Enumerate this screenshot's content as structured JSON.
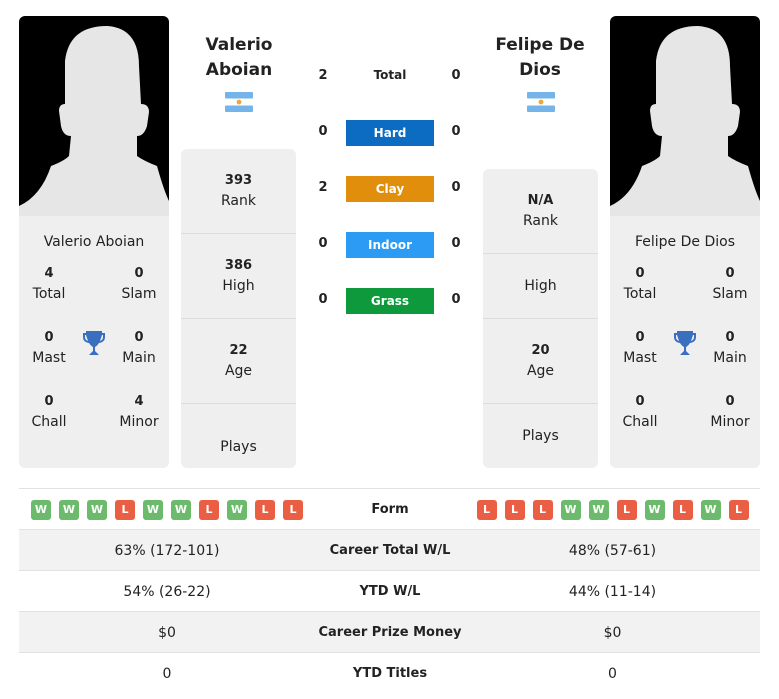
{
  "player1": {
    "name": "Valerio Aboian",
    "name_line1": "Valerio",
    "name_line2": "Aboian",
    "country_flag": "argentina-flag",
    "titles": {
      "total": {
        "value": "4",
        "label": "Total"
      },
      "slam": {
        "value": "0",
        "label": "Slam"
      },
      "mast": {
        "value": "0",
        "label": "Mast"
      },
      "main": {
        "value": "0",
        "label": "Main"
      },
      "chall": {
        "value": "0",
        "label": "Chall"
      },
      "minor": {
        "value": "4",
        "label": "Minor"
      }
    },
    "stats": {
      "rank": {
        "value": "393",
        "label": "Rank"
      },
      "high": {
        "value": "386",
        "label": "High"
      },
      "age": {
        "value": "22",
        "label": "Age"
      },
      "plays": {
        "value": "",
        "label": "Plays"
      }
    },
    "form": [
      "W",
      "W",
      "W",
      "L",
      "W",
      "W",
      "L",
      "W",
      "L",
      "L"
    ],
    "career_total_wl": "63% (172-101)",
    "ytd_wl": "54% (26-22)",
    "career_prize_money": "$0",
    "ytd_titles": "0"
  },
  "player2": {
    "name": "Felipe De Dios",
    "name_line1": "Felipe De",
    "name_line2": "Dios",
    "country_flag": "argentina-flag",
    "titles": {
      "total": {
        "value": "0",
        "label": "Total"
      },
      "slam": {
        "value": "0",
        "label": "Slam"
      },
      "mast": {
        "value": "0",
        "label": "Mast"
      },
      "main": {
        "value": "0",
        "label": "Main"
      },
      "chall": {
        "value": "0",
        "label": "Chall"
      },
      "minor": {
        "value": "0",
        "label": "Minor"
      }
    },
    "stats": {
      "rank": {
        "value": "N/A",
        "label": "Rank"
      },
      "high": {
        "value": "",
        "label": "High"
      },
      "age": {
        "value": "20",
        "label": "Age"
      },
      "plays": {
        "value": "",
        "label": "Plays"
      }
    },
    "form": [
      "L",
      "L",
      "L",
      "W",
      "W",
      "L",
      "W",
      "L",
      "W",
      "L"
    ],
    "career_total_wl": "48% (57-61)",
    "ytd_wl": "44% (11-14)",
    "career_prize_money": "$0",
    "ytd_titles": "0"
  },
  "h2h": {
    "total": {
      "label": "Total",
      "p1": "2",
      "p2": "0"
    },
    "surfaces": [
      {
        "label": "Hard",
        "p1": "0",
        "p2": "0",
        "color": "#0b6cc2"
      },
      {
        "label": "Clay",
        "p1": "2",
        "p2": "0",
        "color": "#e08e0b"
      },
      {
        "label": "Indoor",
        "p1": "0",
        "p2": "0",
        "color": "#2b9bf4"
      },
      {
        "label": "Grass",
        "p1": "0",
        "p2": "0",
        "color": "#0e9a3c"
      }
    ]
  },
  "table": {
    "form_label": "Form",
    "career_total_wl_label": "Career Total W/L",
    "ytd_wl_label": "YTD W/L",
    "career_prize_money_label": "Career Prize Money",
    "ytd_titles_label": "YTD Titles"
  },
  "colors": {
    "win": "#6cbb6c",
    "loss": "#ea5f44",
    "trophy": "#3a6fbf"
  }
}
